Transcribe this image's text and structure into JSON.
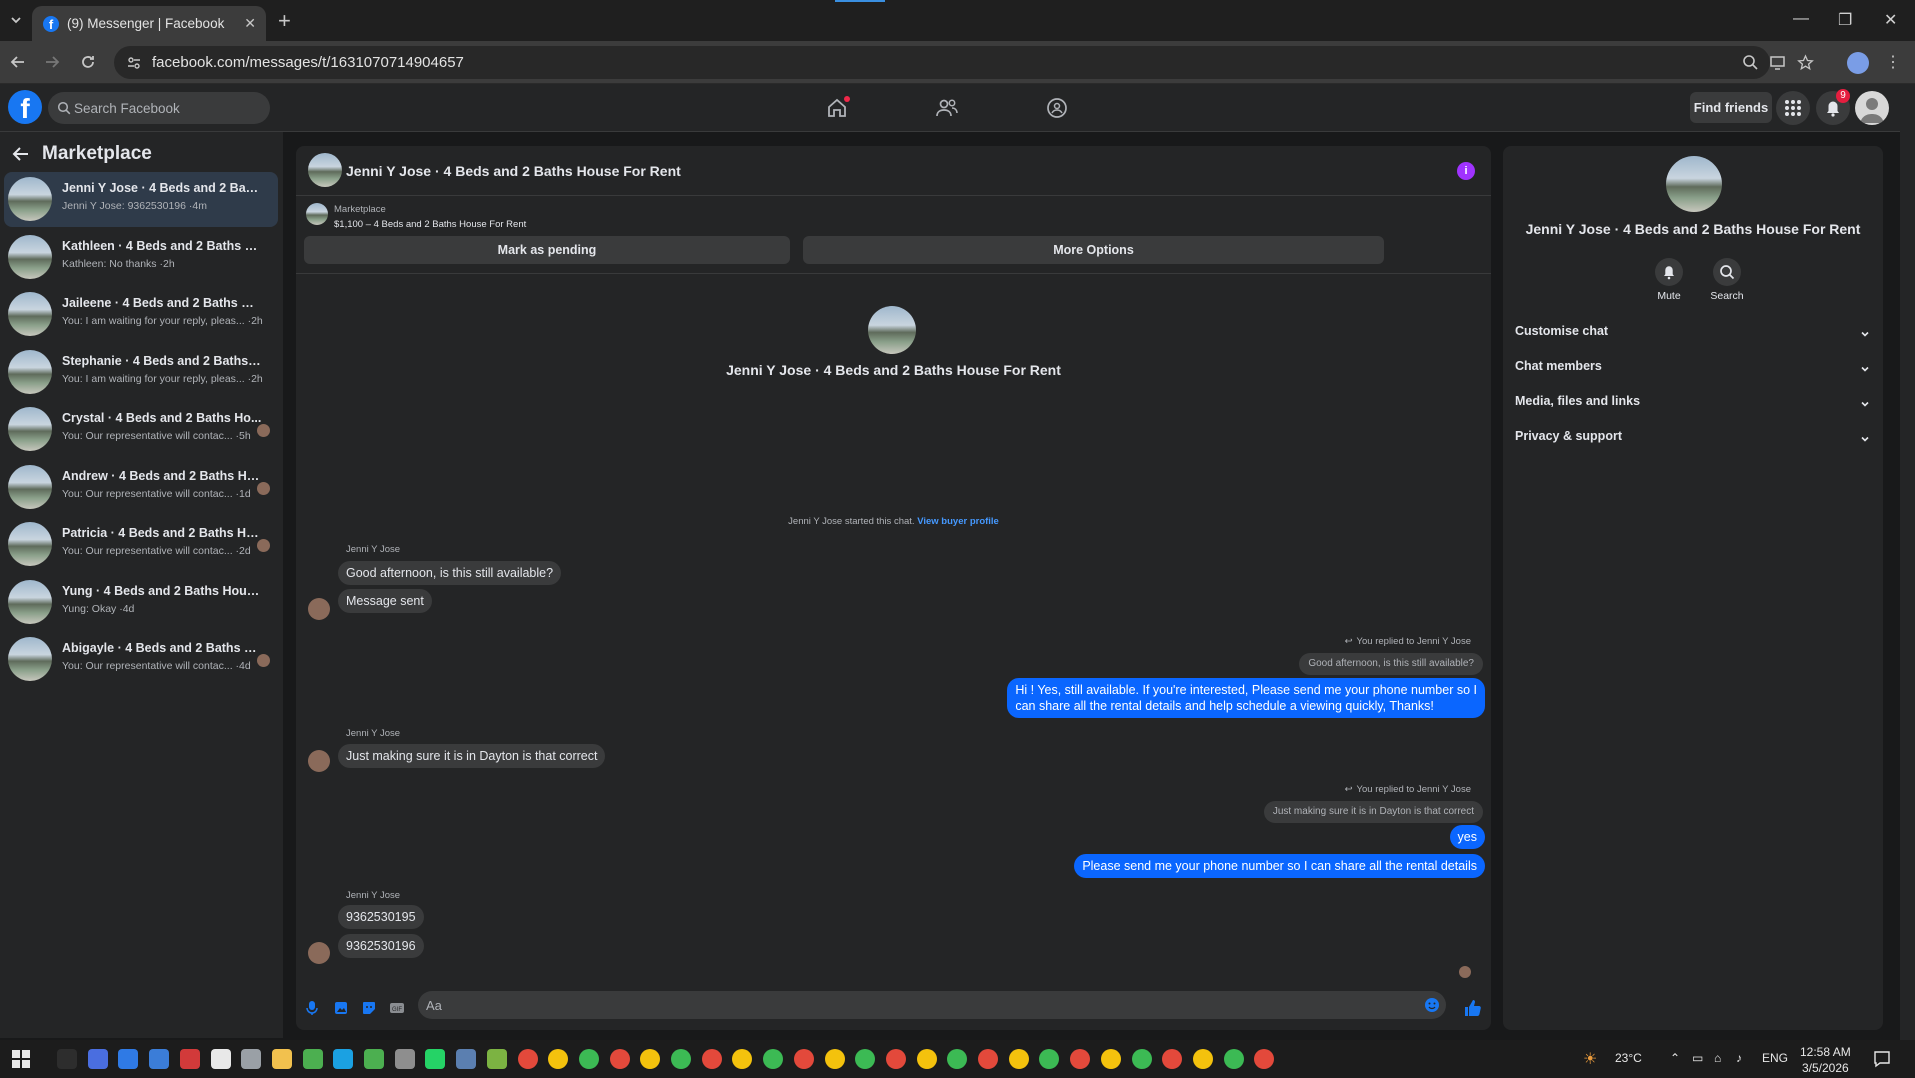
{
  "browser": {
    "tab_title": "(9) Messenger | Facebook",
    "url": "facebook.com/messages/t/1631070714904657"
  },
  "header": {
    "search_placeholder": "Search Facebook",
    "find_friends": "Find friends",
    "notification_count": "9"
  },
  "sidebar": {
    "title": "Marketplace",
    "conversations": [
      {
        "name": "Jenni Y Jose · 4 Beds and 2 Baths ...",
        "preview": "Jenni Y Jose: 9362530196 ·4m",
        "active": true
      },
      {
        "name": "Kathleen · 4 Beds and 2 Baths Hou...",
        "preview": "Kathleen: No thanks ·2h"
      },
      {
        "name": "Jaileene · 4 Beds and 2 Baths Hous...",
        "preview": "You: I am waiting for your reply, pleas... ·2h"
      },
      {
        "name": "Stephanie · 4 Beds and 2 Baths Ho...",
        "preview": "You: I am waiting for your reply, pleas... ·2h"
      },
      {
        "name": "Crystal · 4 Beds and 2 Baths Ho...",
        "preview": "You: Our representative will contac... ·5h"
      },
      {
        "name": "Andrew · 4 Beds and 2 Baths Ho...",
        "preview": "You: Our representative will contac... ·1d"
      },
      {
        "name": "Patricia · 4 Beds and 2 Baths Ho...",
        "preview": "You: Our representative will contac... ·2d"
      },
      {
        "name": "Yung · 4 Beds and 2 Baths House F...",
        "preview": "Yung: Okay ·4d"
      },
      {
        "name": "Abigayle · 4 Beds and 2 Baths H...",
        "preview": "You: Our representative will contac... ·4d"
      }
    ]
  },
  "chat": {
    "title": "Jenni Y Jose · 4 Beds and 2 Baths House For Rent",
    "listing_source": "Marketplace",
    "listing_detail": "$1,100 – 4 Beds and 2 Baths House For Rent",
    "mark_pending": "Mark as pending",
    "more_options": "More Options",
    "center_name": "Jenni Y Jose · 4 Beds and 2 Baths House For Rent",
    "started_text": "Jenni Y Jose started this chat.",
    "view_profile": "View buyer profile",
    "sender_name": "Jenni Y Jose",
    "msg1": "Good afternoon, is this still available?",
    "msg2": "Message sent",
    "replied_label": "You replied to Jenni Y Jose",
    "quote1": "Good afternoon, is this still available?",
    "out1_line1": "Hi ! Yes, still available. If you're interested, Please send me your phone number so I",
    "out1_line2": "can share all the rental details and help schedule a viewing quickly, Thanks!",
    "msg3": "Just making sure it is in Dayton is that correct",
    "quote2": "Just making sure it is in Dayton is that correct",
    "out2": "yes",
    "out3": "Please send me your phone number so I can share all the rental details",
    "msg4": "9362530195",
    "msg5": "9362530196",
    "composer_placeholder": "Aa"
  },
  "info_panel": {
    "name": "Jenni Y Jose · 4 Beds and 2 Baths House For Rent",
    "mute": "Mute",
    "search": "Search",
    "sections": [
      "Customise chat",
      "Chat members",
      "Media, files and links",
      "Privacy & support"
    ]
  },
  "taskbar": {
    "weather": "23°C",
    "lang": "ENG",
    "time": "12:58 AM",
    "date": "3/5/2026"
  },
  "colors": {
    "accent_blue": "#0a66ff",
    "fb_blue": "#1877f2",
    "info_purple": "#a033ff"
  }
}
